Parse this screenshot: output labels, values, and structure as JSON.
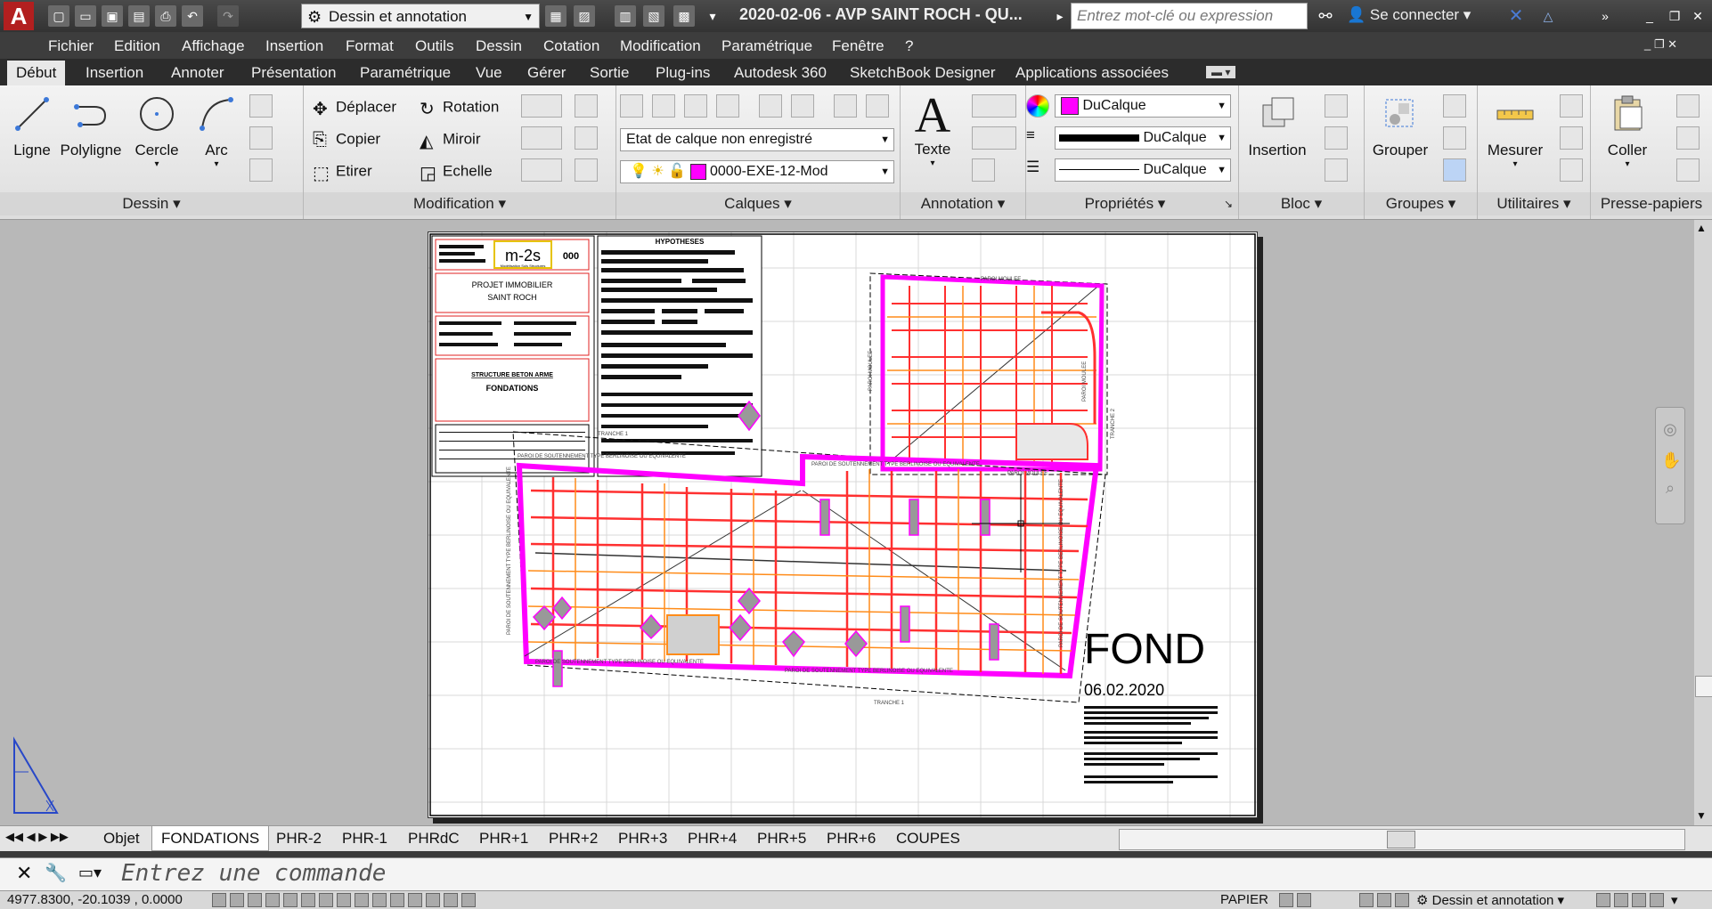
{
  "titlebar": {
    "app_logo": "A",
    "workspace": "Dessin et annotation",
    "document_title": "2020-02-06 - AVP SAINT ROCH - QU...",
    "search_placeholder": "Entrez mot-clé ou expression",
    "sign_in": "Se connecter"
  },
  "menu": [
    "Fichier",
    "Edition",
    "Affichage",
    "Insertion",
    "Format",
    "Outils",
    "Dessin",
    "Cotation",
    "Modification",
    "Paramétrique",
    "Fenêtre",
    "?"
  ],
  "ribbon_tabs": [
    "Début",
    "Insertion",
    "Annoter",
    "Présentation",
    "Paramétrique",
    "Vue",
    "Gérer",
    "Sortie",
    "Plug-ins",
    "Autodesk 360",
    "SketchBook Designer",
    "Applications associées"
  ],
  "ribbon": {
    "dessin": {
      "label": "Dessin",
      "tools": [
        "Ligne",
        "Polyligne",
        "Cercle",
        "Arc"
      ]
    },
    "modification": {
      "label": "Modification",
      "tools": [
        "Déplacer",
        "Rotation",
        "Copier",
        "Miroir",
        "Etirer",
        "Echelle"
      ]
    },
    "calques": {
      "label": "Calques",
      "layer_state": "Etat de calque non enregistré",
      "current_layer": "0000-EXE-12-Mod"
    },
    "annotation": {
      "label": "Annotation",
      "text_tool": "Texte",
      "big_letter": "A"
    },
    "proprietes": {
      "label": "Propriétés",
      "color": "DuCalque",
      "lineweight": "DuCalque",
      "linetype": "DuCalque"
    },
    "bloc": {
      "label": "Bloc",
      "insert": "Insertion"
    },
    "groupes": {
      "label": "Groupes",
      "group": "Grouper"
    },
    "utilitaires": {
      "label": "Utilitaires",
      "measure": "Mesurer"
    },
    "presse_papiers": {
      "label": "Presse-papiers",
      "paste": "Coller"
    }
  },
  "drawing": {
    "title_block": {
      "company": "m-2s",
      "company_sub": "Modélisation Sols Structures",
      "code": "000",
      "project_line1": "PROJET IMMOBILIER",
      "project_line2": "SAINT ROCH",
      "structure": "STRUCTURE BETON ARME",
      "sheet": "FONDATIONS",
      "hypotheses": "HYPOTHESES"
    },
    "big_label": "FOND",
    "date": "06.02.2020",
    "wall_label": "PAROI DE SOUTENNEMENT TYPE BERLINOISE OU EQUIVALENTE",
    "paroi_moulee": "PAROI MOULEE",
    "tranche1": "TRANCHE 1",
    "tranche2": "TRANCHE 2"
  },
  "layout_tabs": [
    "Objet",
    "FONDATIONS",
    "PHR-2",
    "PHR-1",
    "PHRdC",
    "PHR+1",
    "PHR+2",
    "PHR+3",
    "PHR+4",
    "PHR+5",
    "PHR+6",
    "COUPES"
  ],
  "command": {
    "placeholder": "Entrez une commande"
  },
  "status": {
    "coordinates": "4977.8300, -20.1039 , 0.0000",
    "space": "PAPIER",
    "workspace": "Dessin et annotation"
  },
  "colors": {
    "accent_magenta": "#ff00ff",
    "app_red": "#b21f1f",
    "plan_orange": "#ff8c1a",
    "plan_red": "#ff2a2a"
  }
}
